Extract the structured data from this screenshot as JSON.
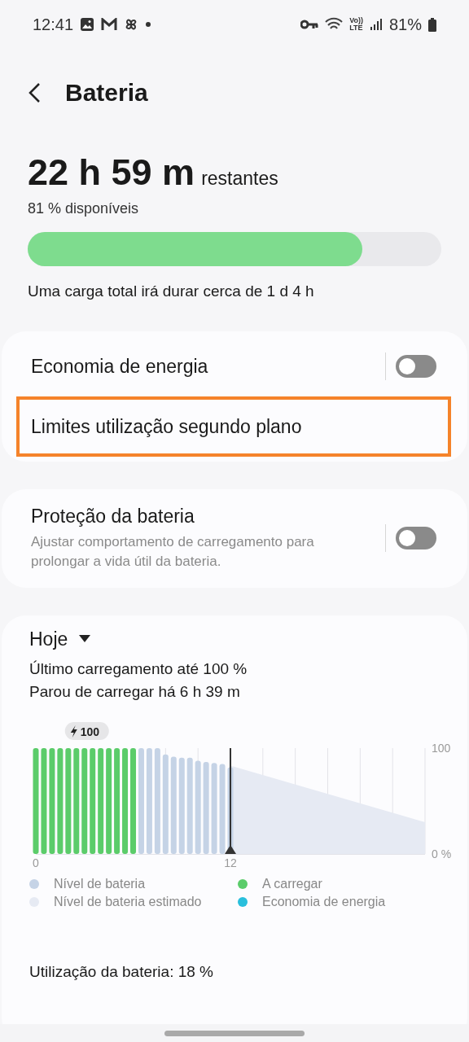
{
  "status_bar": {
    "time": "12:41",
    "volte": "Vo))",
    "lte": "LTE",
    "battery": "81%"
  },
  "header": {
    "title": "Bateria"
  },
  "summary": {
    "time_left": "22 h 59 m",
    "time_left_suffix": "restantes",
    "available": "81 % disponíveis",
    "level": 0.81,
    "full_charge": "Uma carga total irá durar cerca de 1 d 4 h"
  },
  "settings_card": {
    "items": [
      {
        "kind": "toggle",
        "label": "Economia de energia",
        "on": false,
        "highlighted": false
      },
      {
        "kind": "link",
        "label": "Limites utilização segundo plano",
        "highlighted": true
      }
    ]
  },
  "protection_card": {
    "items": [
      {
        "kind": "toggle",
        "label": "Proteção da bateria",
        "description": "Ajustar comportamento de carregamento para prolongar a vida útil da bateria.",
        "on": false,
        "highlighted": false
      }
    ]
  },
  "usage_card": {
    "period": "Hoje",
    "charge_info": [
      "Último carregamento até 100 %",
      "Parou de carregar há 6 h 39 m"
    ],
    "badge": "100",
    "chart_data": {
      "type": "bar",
      "x": [
        0,
        0.5,
        1,
        1.5,
        2,
        2.5,
        3,
        3.5,
        4,
        4.5,
        5,
        5.5,
        6,
        6.5,
        7,
        7.5,
        8,
        8.5,
        9,
        9.5,
        10,
        10.5,
        11,
        11.5,
        12
      ],
      "xlim": [
        0,
        24
      ],
      "ylim": [
        0,
        100
      ],
      "ref_lines": [
        {
          "axis": "x",
          "value": 12
        }
      ],
      "xticks": [
        0,
        12
      ],
      "yticks": [
        {
          "value": 0,
          "label": "0 %"
        },
        {
          "value": 100,
          "label": "100"
        }
      ],
      "series": [
        {
          "name": "A carregar",
          "color": "#5bcc6a",
          "values": [
            100,
            100,
            100,
            100,
            100,
            100,
            100,
            100,
            100,
            100,
            100,
            100,
            100,
            null,
            null,
            null,
            null,
            null,
            null,
            null,
            null,
            null,
            null,
            null,
            null
          ]
        },
        {
          "name": "Nível de bateria",
          "color": "#c5d3e6",
          "values": [
            null,
            null,
            null,
            null,
            null,
            null,
            null,
            null,
            null,
            null,
            null,
            null,
            null,
            100,
            100,
            100,
            94,
            92,
            91,
            91,
            88,
            87,
            86,
            85,
            82
          ]
        }
      ]
    },
    "legend": [
      {
        "label": "Nível de bateria estimado",
        "color": "#e6eaf3"
      },
      {
        "label": "Economia de energia",
        "color": "#29bfdc"
      }
    ],
    "usage_total": "Utilização da bateria: 18 %"
  }
}
